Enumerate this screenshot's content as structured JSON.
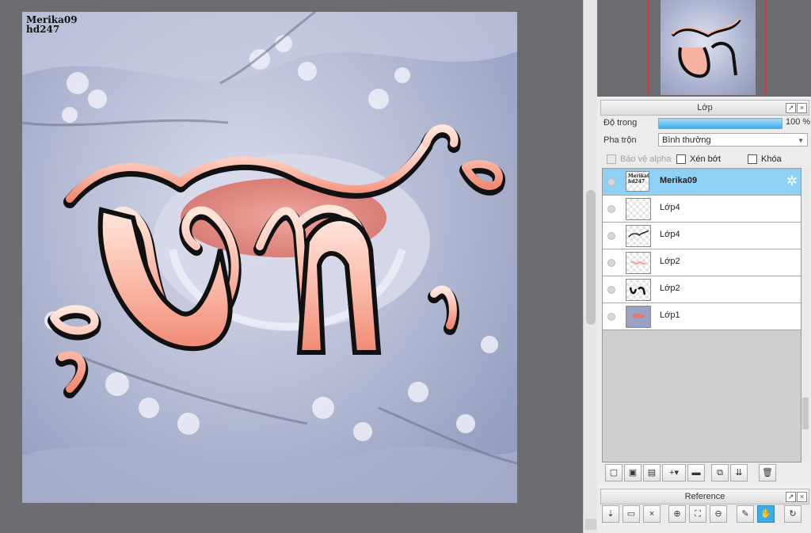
{
  "artwork": {
    "watermark_line1": "Merika09",
    "watermark_line2": "hd247",
    "lettering": "vn"
  },
  "layer_panel": {
    "title": "Lớp",
    "opacity_label": "Độ trong",
    "opacity_value": "100 %",
    "opacity_fraction": 1.0,
    "blend_label": "Pha trộn",
    "blend_value": "Bình thường",
    "protect_alpha_label": "Bảo vệ alpha",
    "clipping_label": "Xén bớt",
    "lock_label": "Khóa",
    "layers": [
      {
        "name": "Merika09",
        "thumb_text": "Merika09 hd247",
        "active": true
      },
      {
        "name": "Lớp4",
        "active": false
      },
      {
        "name": "Lớp4",
        "active": false
      },
      {
        "name": "Lớp2",
        "active": false
      },
      {
        "name": "Lớp2",
        "active": false
      },
      {
        "name": "Lớp1",
        "active": false
      }
    ]
  },
  "reference_panel": {
    "title": "Reference"
  },
  "colors": {
    "accent": "#3aaee8",
    "active_layer": "#8fd0f6",
    "navigator_frame": "#d23a3a",
    "lettering_top": "#ffd8cc",
    "lettering_bottom": "#f08a74"
  }
}
